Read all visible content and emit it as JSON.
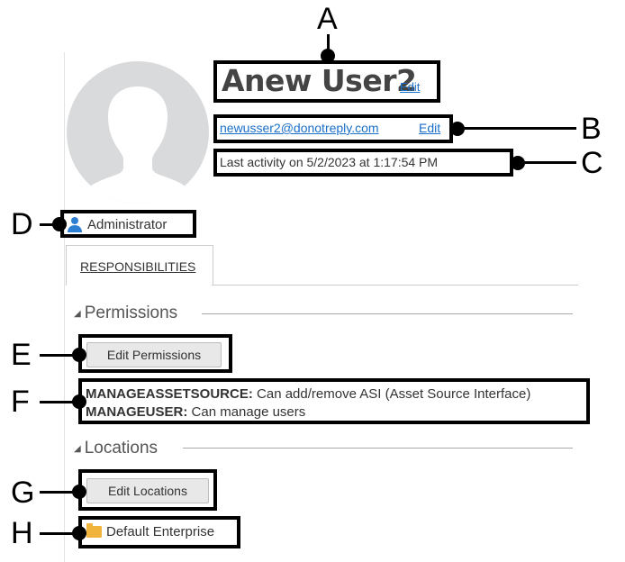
{
  "profile": {
    "name": "Anew User2",
    "name_edit": "Edit",
    "email": "newusser2@donotreply.com",
    "email_edit": "Edit",
    "last_activity": "Last activity on 5/2/2023 at 1:17:54 PM",
    "role": "Administrator"
  },
  "tabs": [
    {
      "label": "RESPONSIBILITIES"
    }
  ],
  "permissions": {
    "heading": "Permissions",
    "edit_button": "Edit Permissions",
    "items": [
      {
        "code": "MANAGEASSETSOURCE:",
        "desc": "Can add/remove ASI (Asset Source Interface)"
      },
      {
        "code": "MANAGEUSER:",
        "desc": "Can manage users"
      }
    ]
  },
  "locations": {
    "heading": "Locations",
    "edit_button": "Edit Locations",
    "items": [
      {
        "label": "Default Enterprise",
        "icon": "folder-icon"
      }
    ]
  },
  "callouts": [
    "A",
    "B",
    "C",
    "D",
    "E",
    "F",
    "G",
    "H"
  ],
  "colors": {
    "link": "#1a6fc9",
    "avatar_bg": "#d9dadb",
    "avatar_fg": "#ffffff",
    "role_icon": "#2d7fd3",
    "folder": "#f0b43c"
  }
}
